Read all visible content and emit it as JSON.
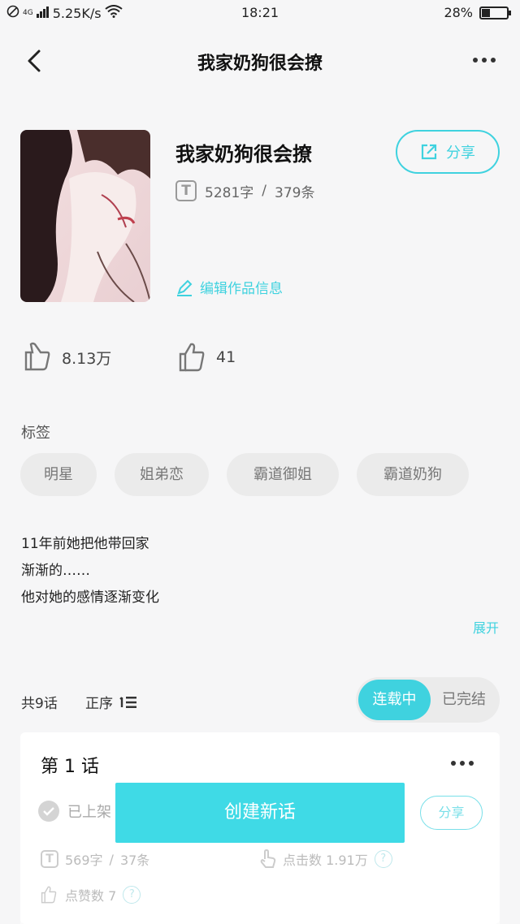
{
  "status_bar": {
    "network": "4G",
    "speed": "5.25K/s",
    "time": "18:21",
    "battery": "28%"
  },
  "nav": {
    "title": "我家奶狗很会撩"
  },
  "book": {
    "title": "我家奶狗很会撩",
    "words": "5281字",
    "separator": "/",
    "comments": "379条",
    "share_label": "分享",
    "edit_label": "编辑作品信息",
    "t_glyph": "T"
  },
  "likes": {
    "views": "8.13万",
    "thumbs": "41"
  },
  "tags": {
    "label": "标签",
    "items": [
      "明星",
      "姐弟恋",
      "霸道御姐",
      "霸道奶狗"
    ]
  },
  "description": {
    "lines": [
      "11年前她把他带回家",
      "渐渐的……",
      "他对她的感情逐渐变化"
    ],
    "expand_label": "展开"
  },
  "chapters": {
    "total": "共9话",
    "order": "正序",
    "tab_active": "连载中",
    "tab_inactive": "已完结",
    "first": {
      "name": "第 1 话",
      "status": "已上架",
      "share_label": "分享",
      "words": "569字",
      "separator": "/",
      "comments": "37条",
      "clicks": "点击数 1.91万",
      "likes": "点赞数 7",
      "q": "?"
    }
  },
  "create_button": "创建新话",
  "colors": {
    "accent": "#3fd2df",
    "tag_bg": "#ebebeb",
    "page_bg": "#f6f6f7"
  }
}
